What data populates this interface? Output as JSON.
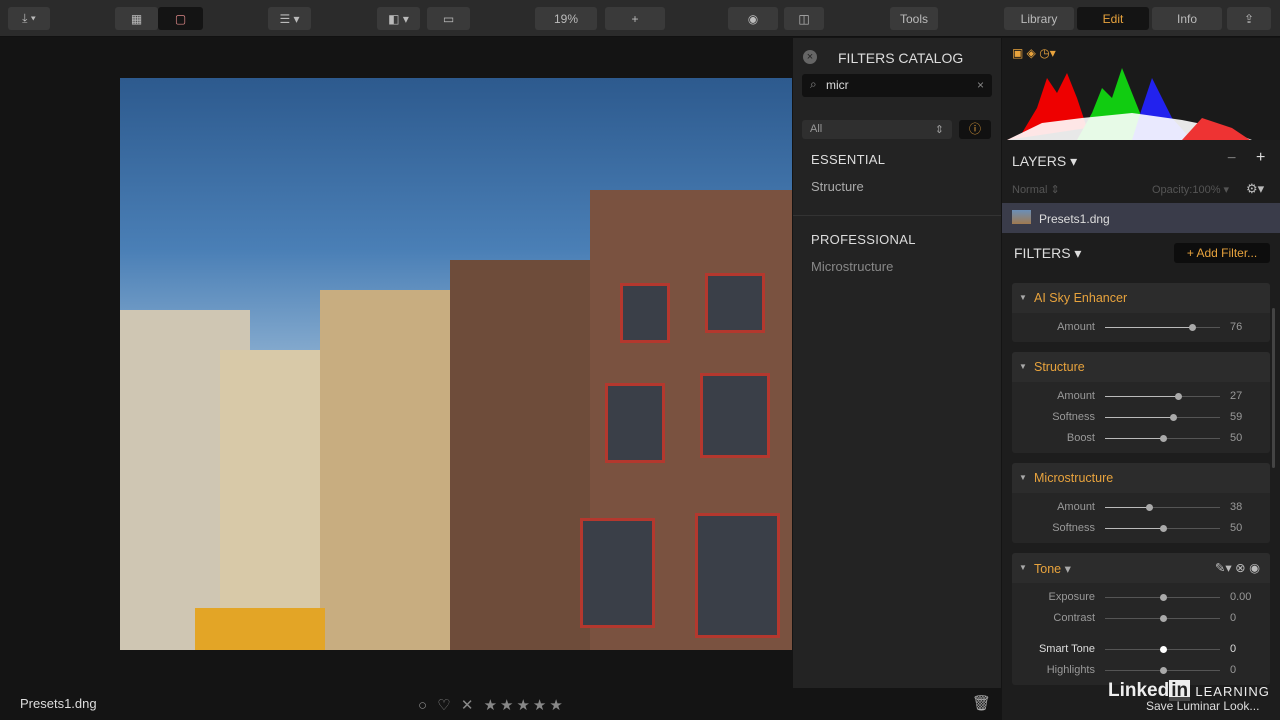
{
  "toolbar": {
    "zoom": "19%",
    "tools": "Tools",
    "tabs": [
      "Library",
      "Edit",
      "Info"
    ],
    "active_tab": "Edit"
  },
  "photo": {
    "filename": "Presets1.dng"
  },
  "bottom": {
    "rating_stars": 5
  },
  "catalog": {
    "title": "FILTERS CATALOG",
    "search_value": "micr",
    "category": "All",
    "sections": [
      {
        "title": "ESSENTIAL",
        "items": [
          "Structure"
        ]
      },
      {
        "title": "PROFESSIONAL",
        "items": [
          "Microstructure"
        ]
      }
    ]
  },
  "layers": {
    "title": "LAYERS",
    "blend": "Normal",
    "opacity_label": "Opacity:",
    "opacity": "100%",
    "layer_name": "Presets1.dng"
  },
  "filters": {
    "title": "FILTERS",
    "add_label": "+ Add Filter...",
    "items": [
      {
        "name": "AI Sky Enhancer",
        "params": [
          {
            "label": "Amount",
            "value": "76",
            "pos": 0.76
          }
        ]
      },
      {
        "name": "Structure",
        "params": [
          {
            "label": "Amount",
            "value": "27",
            "pos": 0.635
          },
          {
            "label": "Softness",
            "value": "59",
            "pos": 0.59
          },
          {
            "label": "Boost",
            "value": "50",
            "pos": 0.5
          }
        ]
      },
      {
        "name": "Microstructure",
        "params": [
          {
            "label": "Amount",
            "value": "38",
            "pos": 0.38
          },
          {
            "label": "Softness",
            "value": "50",
            "pos": 0.5
          }
        ]
      },
      {
        "name": "Tone",
        "params": [
          {
            "label": "Exposure",
            "value": "0.00",
            "pos": 0.5
          },
          {
            "label": "Contrast",
            "value": "0",
            "pos": 0.5
          },
          {
            "label": "Smart Tone",
            "value": "0",
            "pos": 0.5
          },
          {
            "label": "Highlights",
            "value": "0",
            "pos": 0.5
          }
        ]
      }
    ]
  },
  "overlay": {
    "brand": "Linkedin LEARNING",
    "save_look": "Save Luminar Look..."
  },
  "colors": {
    "accent": "#e8a33d"
  }
}
